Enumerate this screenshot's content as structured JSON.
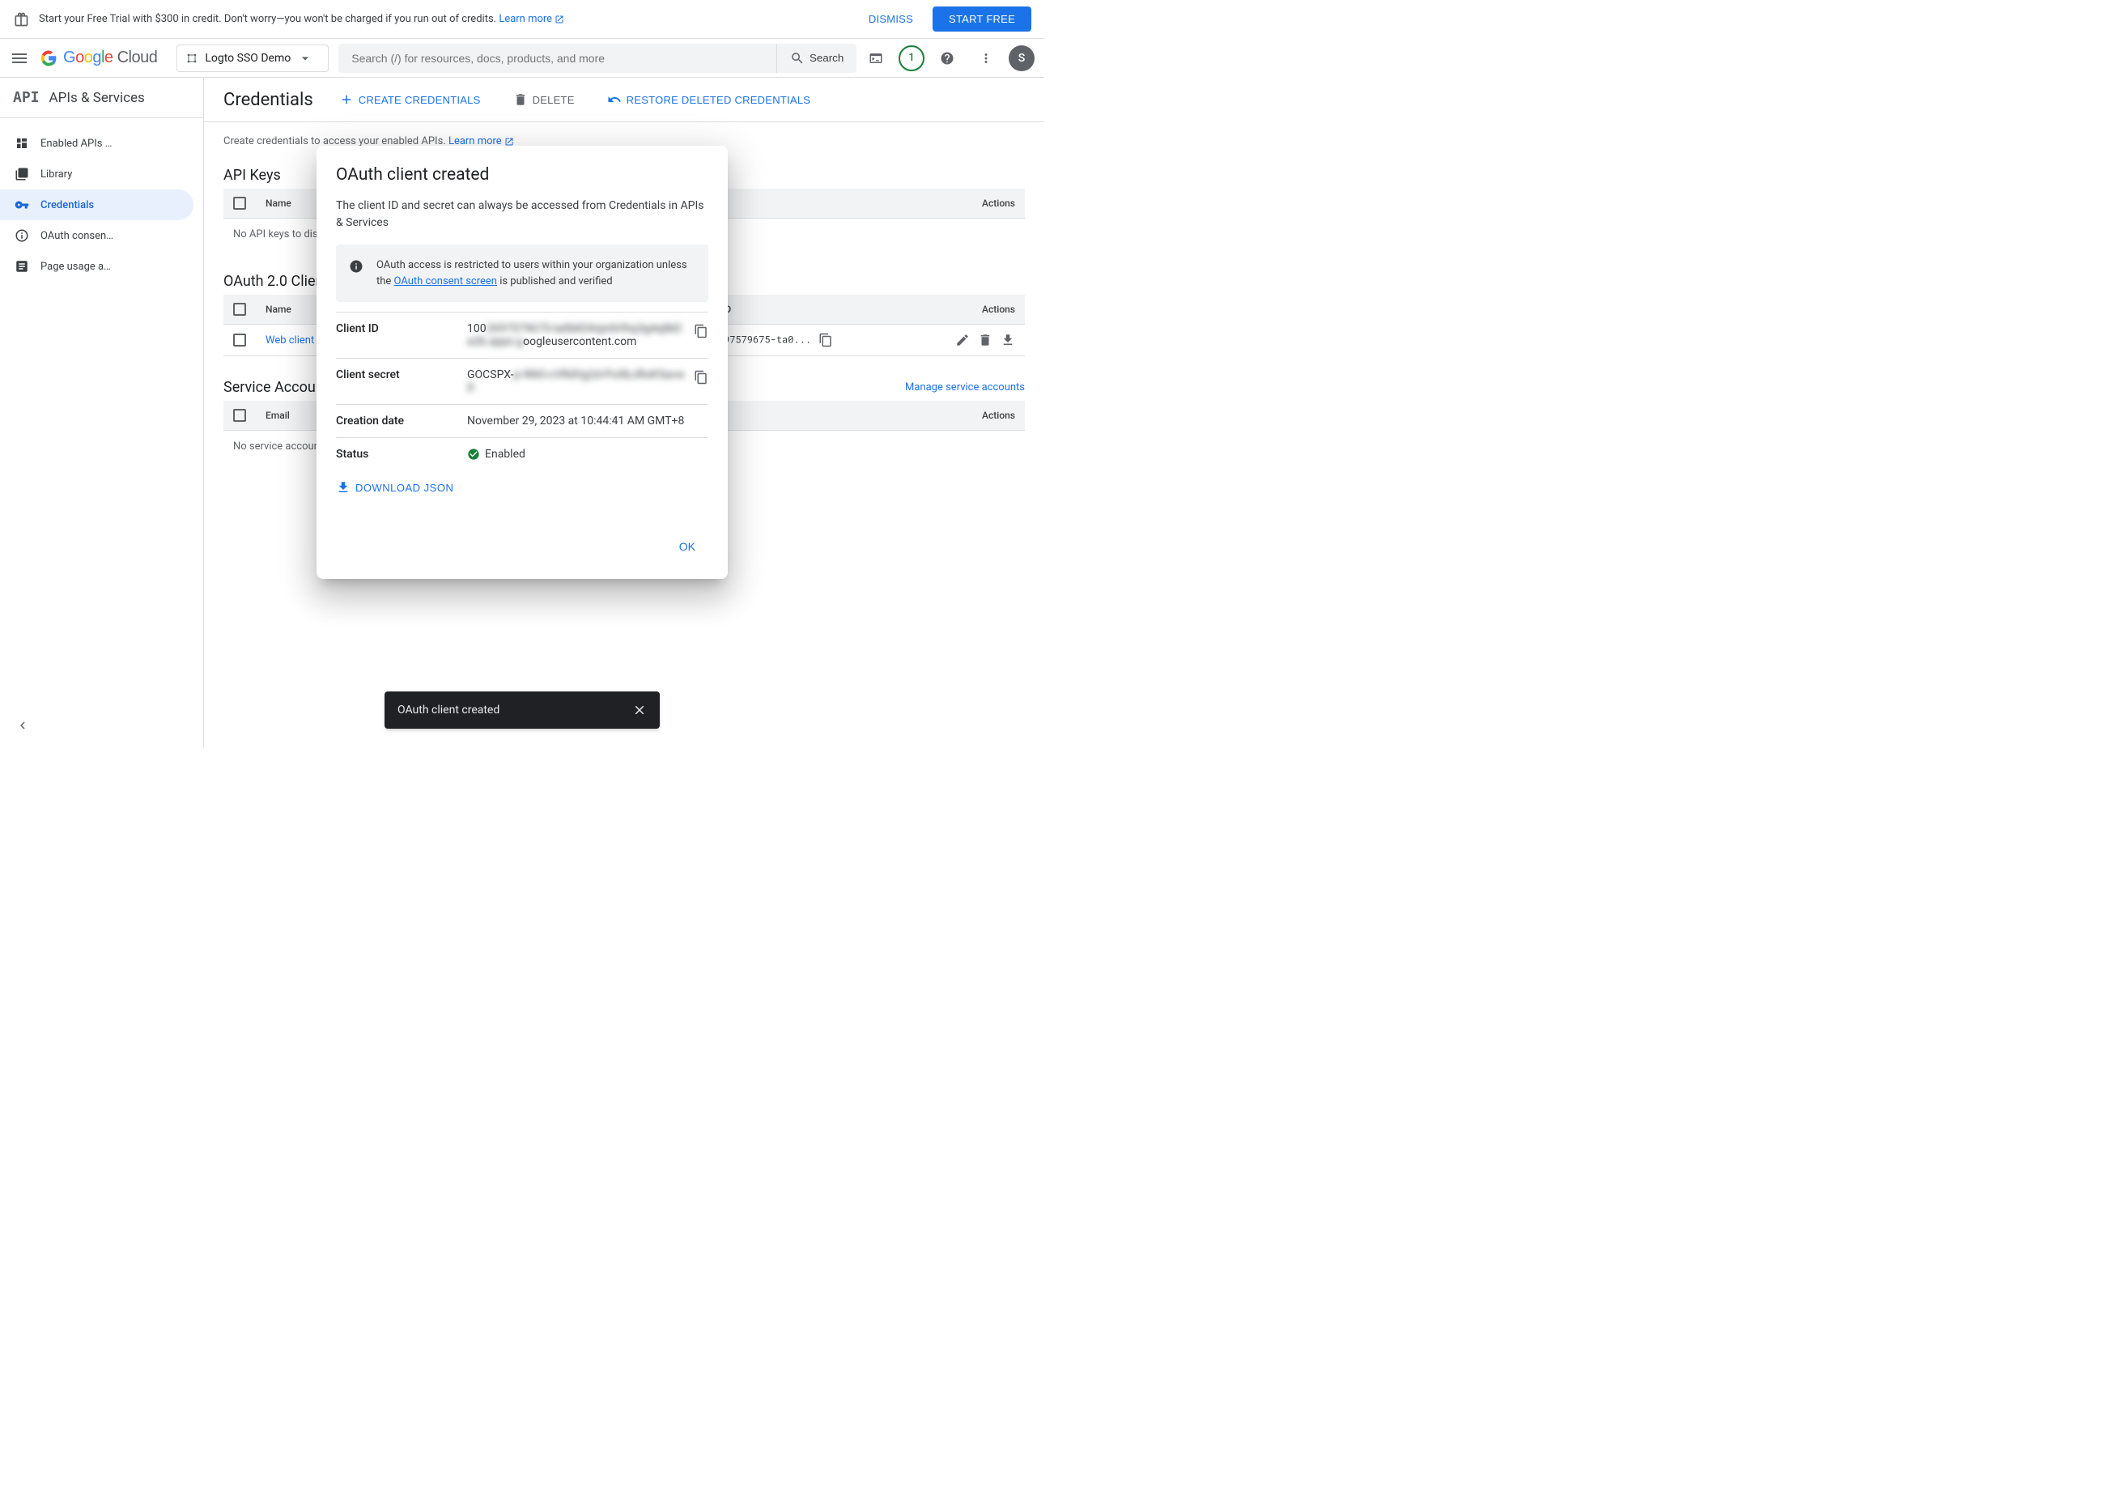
{
  "banner": {
    "text": "Start your Free Trial with $300 in credit. Don't worry—you won't be charged if you run out of credits. ",
    "learn_more": "Learn more",
    "dismiss": "DISMISS",
    "start_free": "START FREE"
  },
  "header": {
    "logo": "Google Cloud",
    "project": "Logto SSO Demo",
    "search_placeholder": "Search (/) for resources, docs, products, and more",
    "search_label": "Search",
    "badge": "1",
    "avatar": "S"
  },
  "sidebar": {
    "title": "APIs & Services",
    "items": [
      {
        "label": "Enabled APIs …"
      },
      {
        "label": "Library"
      },
      {
        "label": "Credentials"
      },
      {
        "label": "OAuth consen…"
      },
      {
        "label": "Page usage a…"
      }
    ]
  },
  "page": {
    "title": "Credentials",
    "create": "CREATE CREDENTIALS",
    "delete": "DELETE",
    "restore": "RESTORE DELETED CREDENTIALS",
    "intro": "Create credentials to access your enabled APIs. ",
    "intro_link": "Learn more"
  },
  "sections": {
    "api_keys": {
      "title": "API Keys",
      "cols": {
        "name": "Name",
        "actions": "Actions"
      },
      "empty": "No API keys to display"
    },
    "oauth_clients": {
      "title": "OAuth 2.0 Client IDs",
      "cols": {
        "name": "Name",
        "client_id": "Client ID",
        "actions": "Actions"
      },
      "rows": [
        {
          "name": "Web client",
          "client_id": "1002697579675-ta0..."
        }
      ]
    },
    "service_accounts": {
      "title": "Service Accounts",
      "manage": "Manage service accounts",
      "cols": {
        "email": "Email",
        "actions": "Actions"
      },
      "empty": "No service accounts to display"
    }
  },
  "modal": {
    "title": "OAuth client created",
    "desc": "The client ID and secret can always be accessed from Credentials in APIs & Services",
    "info_pre": "OAuth access is restricted to users within your organization unless the ",
    "info_link": "OAuth consent screen",
    "info_post": " is published and verified",
    "fields": {
      "client_id_label": "Client ID",
      "client_id_prefix": "100",
      "client_id_blur": "2697579675-ta0b834sjn0rl9sj3g4q8k0a2b.apps.g",
      "client_id_suffix": "oogleusercontent.com",
      "client_secret_label": "Client secret",
      "client_secret_prefix": "GOCSPX-",
      "client_secret_blur": "p-Wk0-cVRdVg2d-PoXbJRoK5avwD",
      "creation_label": "Creation date",
      "creation_value": "November 29, 2023 at 10:44:41 AM GMT+8",
      "status_label": "Status",
      "status_value": "Enabled"
    },
    "download": "DOWNLOAD JSON",
    "ok": "OK"
  },
  "toast": {
    "text": "OAuth client created"
  }
}
